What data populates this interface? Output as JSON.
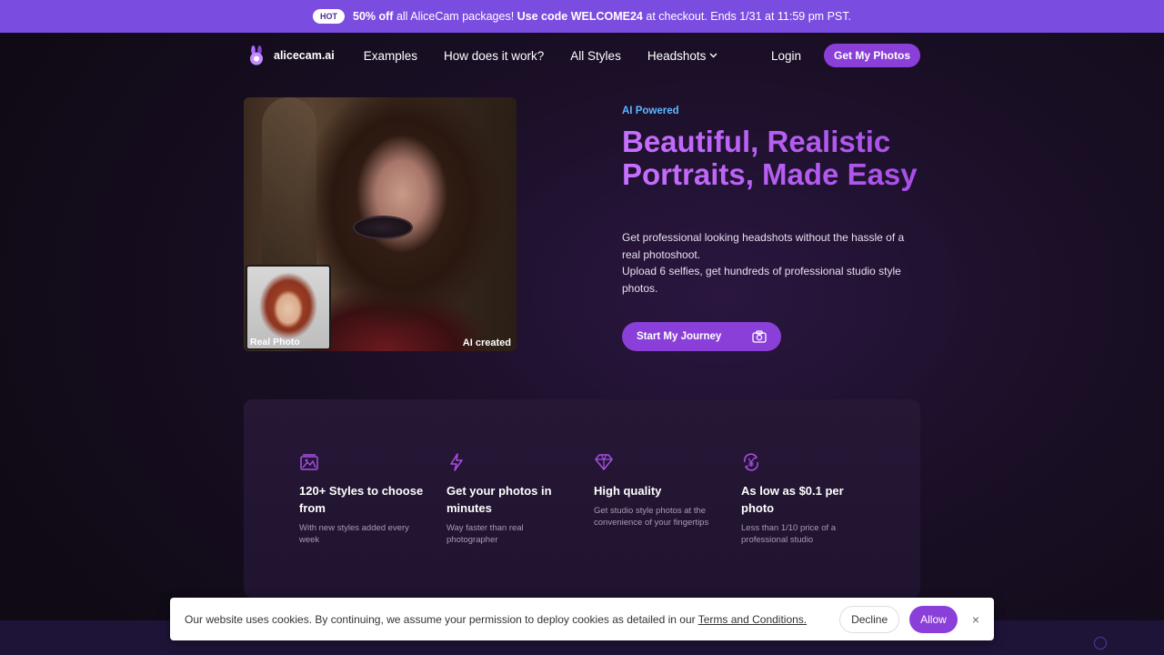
{
  "promo": {
    "badge": "HOT",
    "discount": "50% off",
    "text1": " all AliceCam packages! ",
    "code_prefix": "Use code WELCOME24",
    "text2": " at checkout. Ends 1/31 at 11:59 pm PST."
  },
  "nav": {
    "logo": "alicecam.ai",
    "links": [
      "Examples",
      "How does it work?",
      "All Styles",
      "Headshots"
    ],
    "login": "Login",
    "cta": "Get My Photos"
  },
  "hero": {
    "real_label": "Real Photo",
    "ai_label": "AI created",
    "eyebrow": "AI Powered",
    "headline": "Beautiful, Realistic Portraits, Made Easy",
    "sub1": "Get professional looking headshots without the hassle of a real photoshoot.",
    "sub2": "Upload 6 selfies, get hundreds of professional studio style photos.",
    "cta": "Start My Journey"
  },
  "features": [
    {
      "icon": "image-gallery-icon",
      "title": "120+ Styles to choose from",
      "desc": "With new styles added every week"
    },
    {
      "icon": "lightning-icon",
      "title": "Get your photos in minutes",
      "desc": "Way faster than real photographer"
    },
    {
      "icon": "diamond-icon",
      "title": "High quality",
      "desc": "Get studio style photos at the convenience of your fingertips"
    },
    {
      "icon": "yen-exchange-icon",
      "title": "As low as $0.1 per photo",
      "desc": "Less than 1/10 price of a professional studio"
    }
  ],
  "cookie": {
    "text": "Our website uses cookies. By continuing, we assume your permission to deploy cookies as detailed in our ",
    "link": "Terms and Conditions.",
    "decline": "Decline",
    "allow": "Allow",
    "close": "×"
  },
  "colors": {
    "accent": "#8b3fd9",
    "promo_bg": "#7b4ce0",
    "eyebrow": "#5cb7ff"
  }
}
